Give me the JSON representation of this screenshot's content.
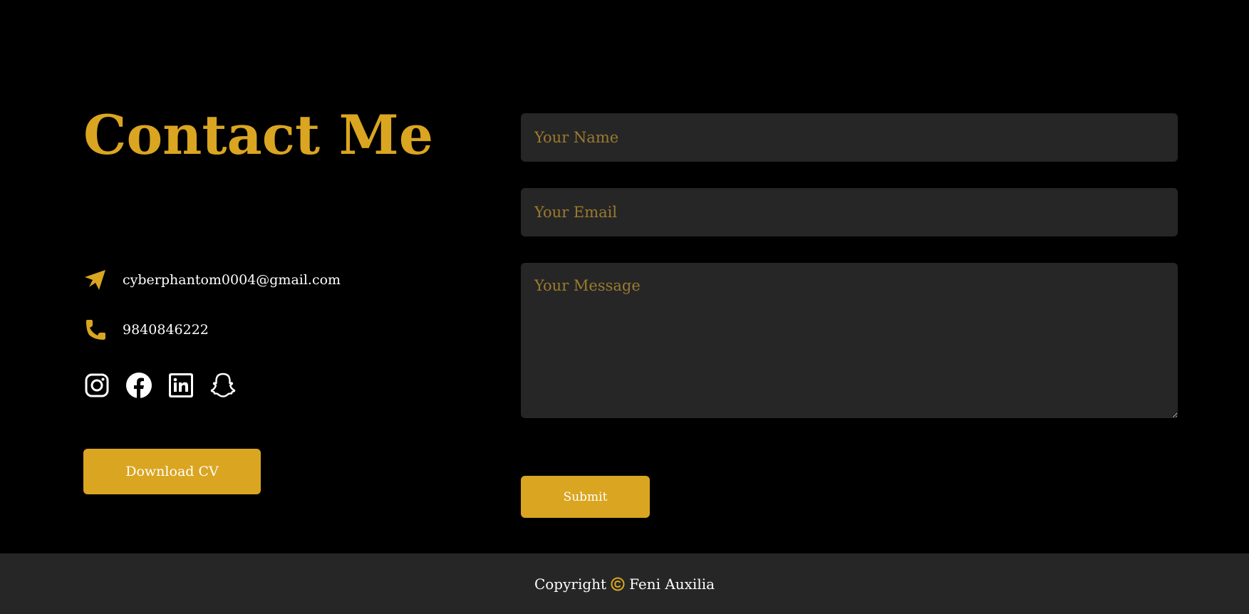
{
  "contact": {
    "title": "Contact Me",
    "email": "cyberphantom0004@gmail.com",
    "phone": "9840846222",
    "socials": [
      {
        "icon": "instagram-icon"
      },
      {
        "icon": "facebook-icon"
      },
      {
        "icon": "linkedin-icon"
      },
      {
        "icon": "snapchat-icon"
      }
    ],
    "cv_button_label": "Download CV"
  },
  "form": {
    "name_placeholder": "Your Name",
    "name_value": "",
    "email_placeholder": "Your Email",
    "email_value": "",
    "message_placeholder": "Your Message",
    "message_value": "",
    "submit_label": "Submit"
  },
  "footer": {
    "prefix": "Copyright",
    "owner": "Feni Auxilia"
  },
  "colors": {
    "accent": "#daa520",
    "background": "#000000",
    "panel": "#262626",
    "text": "#ffffff",
    "placeholder": "#9a7a2e"
  }
}
